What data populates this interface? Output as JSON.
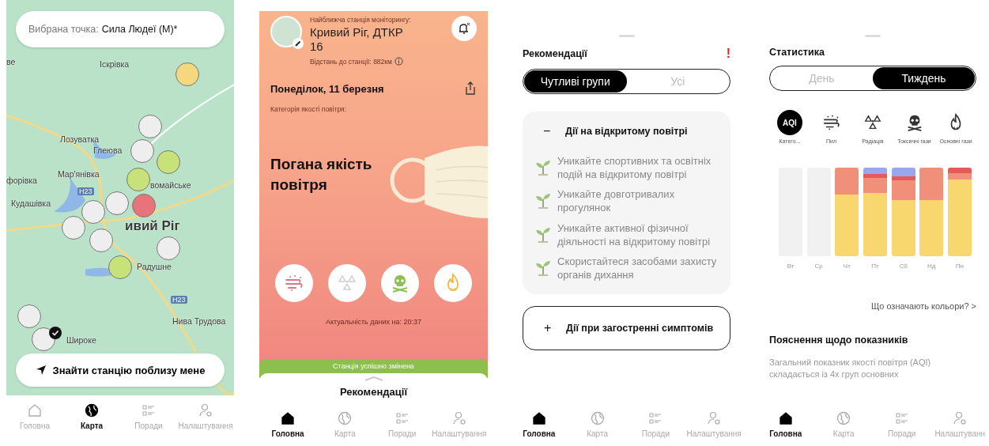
{
  "map_screen": {
    "selected_point": {
      "label": "Вибрана точка:",
      "value": "Сила Людеї (М)*"
    },
    "map_labels": [
      "ве",
      "Іскрівка",
      "Лозуватка",
      "Глеюва",
      "Мар'янівка",
      "форівка",
      "вомайське",
      "H23",
      "Кудашівка",
      "ивий Ріг",
      "Радушне",
      "H23",
      "Нива Трудова",
      "Широке"
    ],
    "markers": [
      {
        "color": "#f5d77d",
        "selected": false
      },
      {
        "color": "#eeeeee",
        "selected": false
      },
      {
        "color": "#eeeeee",
        "selected": false
      },
      {
        "color": "#c8e27a",
        "selected": false
      },
      {
        "color": "#c8e27a",
        "selected": false
      },
      {
        "color": "#eeeeee",
        "selected": false
      },
      {
        "color": "#eeeeee",
        "selected": false
      },
      {
        "color": "#eeeeee",
        "selected": false
      },
      {
        "color": "#e8737a",
        "selected": false
      },
      {
        "color": "#eeeeee",
        "selected": false
      },
      {
        "color": "#eeeeee",
        "selected": false
      },
      {
        "color": "#c8e27a",
        "selected": false
      },
      {
        "color": "#eeeeee",
        "selected": false
      },
      {
        "color": "#eeeeee",
        "selected": true
      }
    ],
    "locate_button": "Знайти станцію поблизу мене",
    "nav": [
      {
        "kind": "home",
        "label": "Головна",
        "selected": false
      },
      {
        "kind": "map",
        "label": "Карта",
        "selected": true
      },
      {
        "kind": "tips",
        "label": "Поради",
        "selected": false
      },
      {
        "kind": "settings",
        "label": "Налаштування",
        "selected": false
      }
    ]
  },
  "home_screen": {
    "station_caption": "Найближча станція моніторингу:",
    "station_name": "Кривий Ріг, ДТКР 16",
    "distance": "Відстань до станції: 882км",
    "date": "Понеділок, 11 березня",
    "category_caption": "Категорія якості повітря:",
    "quality": "Погана якість повітря",
    "pollutants": [
      {
        "kind": "dust",
        "color": "#d9788a"
      },
      {
        "kind": "radiation",
        "color": "#d0d0d0"
      },
      {
        "kind": "toxic",
        "color": "#8cc152"
      },
      {
        "kind": "gas",
        "color": "#f0b64a"
      }
    ],
    "updated": "Актуальність даних на: 20:37",
    "toast": "Станція успішно змінена",
    "sheet_title": "Рекомендації",
    "nav": [
      {
        "kind": "home",
        "label": "Головна",
        "selected": true
      },
      {
        "kind": "map",
        "label": "Карта",
        "selected": false
      },
      {
        "kind": "tips",
        "label": "Поради",
        "selected": false
      },
      {
        "kind": "settings",
        "label": "Налаштування",
        "selected": false
      }
    ]
  },
  "recommendations_screen": {
    "title": "Рекомендації",
    "alert": "!",
    "segments": [
      {
        "label": "Чутливі групи",
        "selected": true
      },
      {
        "label": "Усі",
        "selected": false
      }
    ],
    "sections": [
      {
        "toggle": "−",
        "title": "Дії на відкритому повітрі",
        "expanded": true,
        "items": [
          "Уникайте спортивних та освітніх подій на відкритому повітрі",
          "Уникайте довготривалих прогулянок",
          "Уникайте активної фізичної діяльності на відкритому повітрі",
          "Скористайтеся засобами захисту органів дихання"
        ]
      },
      {
        "toggle": "+",
        "title": "Дії при загостренні симптомів",
        "expanded": false
      }
    ],
    "nav": [
      {
        "kind": "home",
        "label": "Головна",
        "selected": true
      },
      {
        "kind": "map",
        "label": "Карта",
        "selected": false
      },
      {
        "kind": "tips",
        "label": "Поради",
        "selected": false
      },
      {
        "kind": "settings",
        "label": "Налаштування",
        "selected": false
      }
    ]
  },
  "statistics_screen": {
    "title": "Статистика",
    "segments": [
      {
        "label": "День",
        "selected": false
      },
      {
        "label": "Тиждень",
        "selected": true
      }
    ],
    "categories": [
      {
        "kind": "aqi",
        "icon_text": "AQI",
        "label": "Катего...",
        "selected": true
      },
      {
        "kind": "dust",
        "label": "Пил",
        "selected": false
      },
      {
        "kind": "radiation",
        "label": "Радіація",
        "selected": false
      },
      {
        "kind": "toxic",
        "label": "Токсичні гази",
        "selected": false
      },
      {
        "kind": "gas",
        "label": "Основні гази",
        "selected": false
      }
    ],
    "chart": {
      "days": [
        "Вт",
        "Ср",
        "Чт",
        "Пт",
        "Сб",
        "Нд",
        "Пн"
      ]
    },
    "colors_link": "Що означають кольори? >",
    "explanation_title": "Пояснення щодо показників",
    "explanation": "Загальний показник якості повітря (AQI) складається із 4х груп основних",
    "nav": [
      {
        "kind": "home",
        "label": "Головна",
        "selected": true
      },
      {
        "kind": "map",
        "label": "Карта",
        "selected": false
      },
      {
        "kind": "tips",
        "label": "Поради",
        "selected": false
      },
      {
        "kind": "settings",
        "label": "Налаштуванн",
        "selected": false
      }
    ]
  }
}
